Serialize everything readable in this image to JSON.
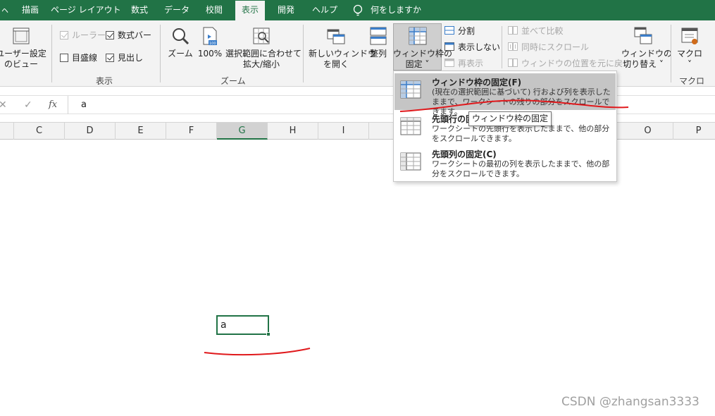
{
  "tabs": {
    "t0": "ㇸ",
    "t1": "描画",
    "t2": "ページ レイアウト",
    "t3": "数式",
    "t4": "データ",
    "t5": "校閲",
    "t6": "表示",
    "t7": "開発",
    "t8": "ヘルプ",
    "tell_me": "何をしますか"
  },
  "ribbon": {
    "custom_view": [
      "ユーザー設定",
      "のビュー"
    ],
    "ruler": "ルーラー",
    "formula_bar": "数式バー",
    "gridlines": "目盛線",
    "headings": "見出し",
    "group_show": "表示",
    "zoom": "ズーム",
    "zoom100": "100%",
    "zoom_to_selection": [
      "選択範囲に合わせて",
      "拡大/縮小"
    ],
    "group_zoom": "ズーム",
    "new_window": [
      "新しいウィンドウ",
      "を開く"
    ],
    "arrange": "整列",
    "freeze_panes": [
      "ウィンドウ枠の",
      "固定 ˅"
    ],
    "split": "分割",
    "hide": "表示しない",
    "unhide": "再表示",
    "view_side_by_side": "並べて比較",
    "sync_scroll": "同時にスクロール",
    "reset_position": "ウィンドウの位置を元に戻す",
    "switch_windows": [
      "ウィンドウの",
      "切り替え ˅"
    ],
    "macros": "マクロ",
    "macros_arrow": "˅",
    "group_macro": "マクロ"
  },
  "formula_bar": {
    "cancel": "✕",
    "enter": "✓",
    "fx": "fx",
    "value": "a"
  },
  "columns": [
    "C",
    "D",
    "E",
    "F",
    "G",
    "H",
    "I",
    "O",
    "P"
  ],
  "selected_column": "G",
  "active_cell_value": "a",
  "menu": {
    "item1": {
      "title": "ウィンドウ枠の固定(F)",
      "desc": "(現在の選択範囲に基づいて) 行および列を表示したままで、ワークシートの残りの部分をスクロールできます。"
    },
    "item2": {
      "title": "先頭行の固定(R)",
      "desc": "ワークシートの先頭行を表示したままで、他の部分をスクロールできます。"
    },
    "item3": {
      "title": "先頭列の固定(C)",
      "desc": "ワークシートの最初の列を表示したままで、他の部分をスクロールできます。"
    }
  },
  "tooltip": "ウィンドウ枠の固定",
  "watermark": "CSDN @zhangsan3333",
  "colors": {
    "excel_green": "#217346",
    "annotation_red": "#e0191c",
    "menu_highlight": "#c5c5c5"
  }
}
